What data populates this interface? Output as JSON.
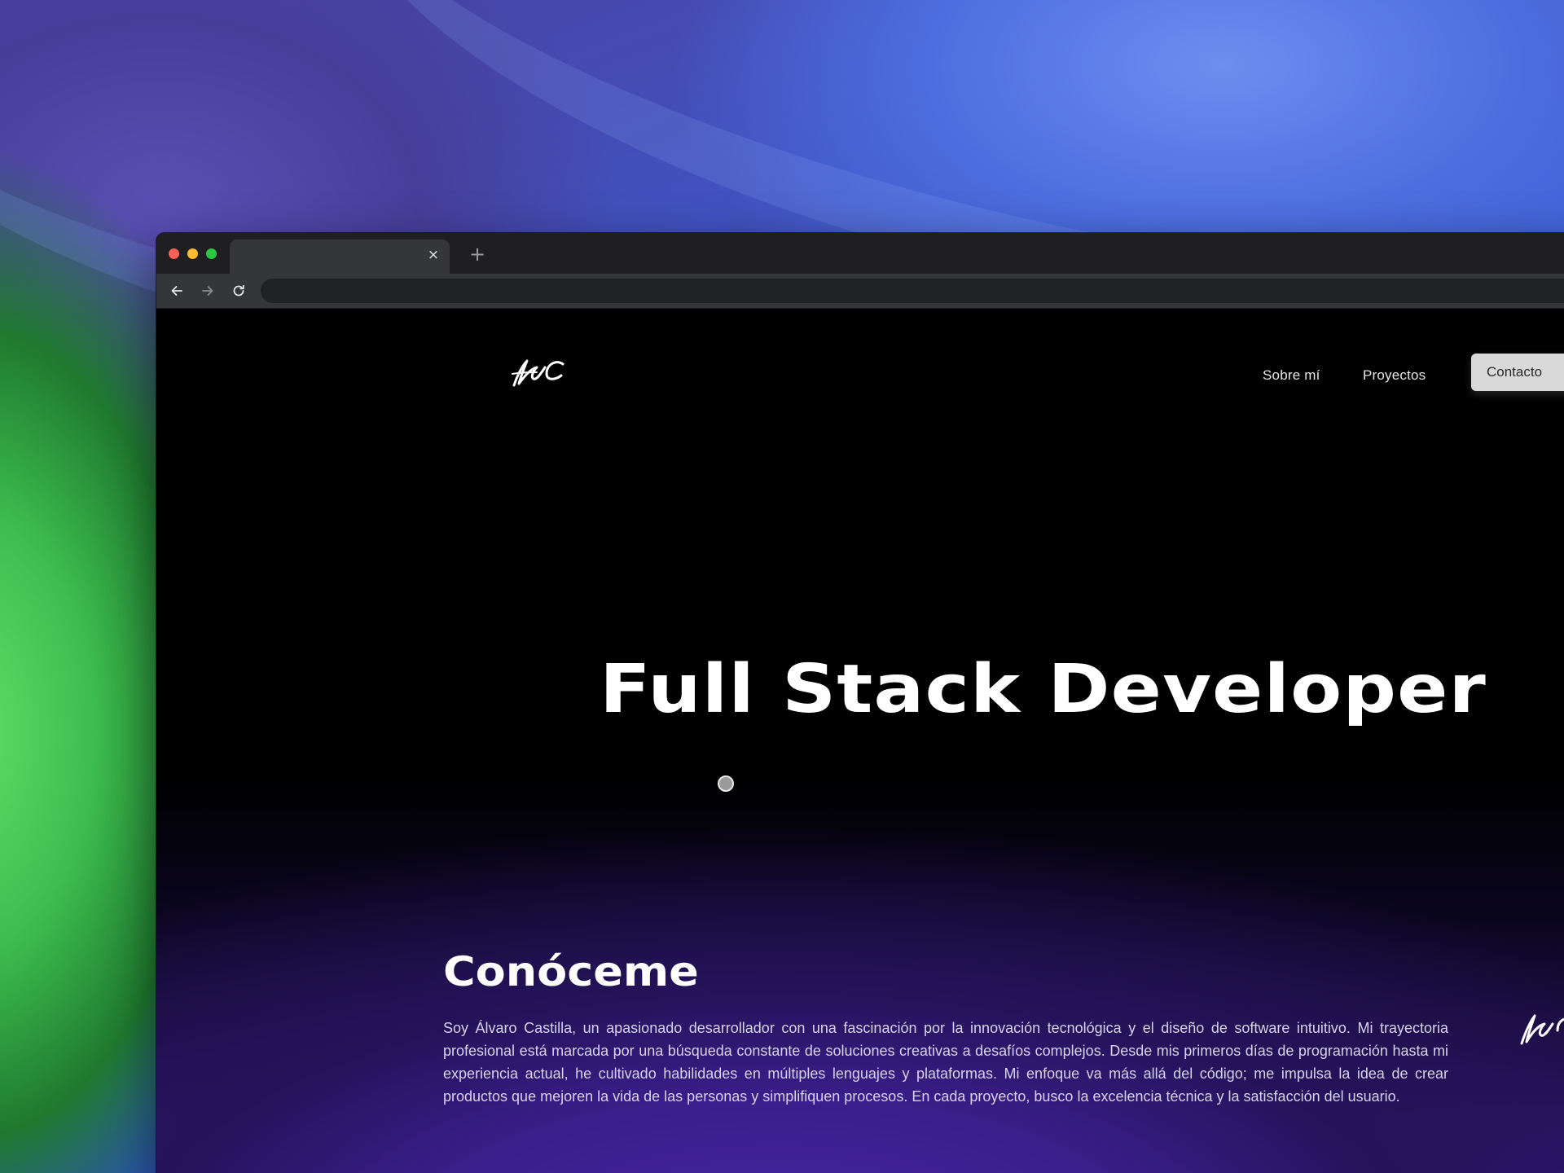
{
  "browser": {
    "tab_close_glyph": "×",
    "new_tab_glyph": "+",
    "omnibox_value": ""
  },
  "site": {
    "logo": {
      "icon": "signature-logo-icon",
      "text": "ÁC"
    },
    "nav": {
      "items": [
        {
          "label": "Sobre mí"
        },
        {
          "label": "Proyectos"
        }
      ],
      "contact_label": "Contacto"
    },
    "hero": {
      "title": "Full Stack Developer"
    },
    "about": {
      "title": "Conóceme",
      "text": "Soy Álvaro Castilla, un apasionado desarrollador con una fascinación por la innovación tecnológica y el diseño de software intuitivo. Mi trayectoria profesional está marcada por una búsqueda constante de soluciones creativas a desafíos complejos. Desde mis primeros días de programación hasta mi experiencia actual, he cultivado habilidades en múltiples lenguajes y plataformas. Mi enfoque va más allá del código; me impulsa la idea de crear productos que mejoren la vida de las personas y simplifiquen procesos. En cada proyecto, busco la excelencia técnica y la satisfacción del usuario."
    }
  },
  "colors": {
    "page_bg_top": "#000000",
    "page_bg_bottom": "#3a1c86",
    "contact_button_bg": "#d9d9d9",
    "browser_chrome": "#35363a"
  }
}
